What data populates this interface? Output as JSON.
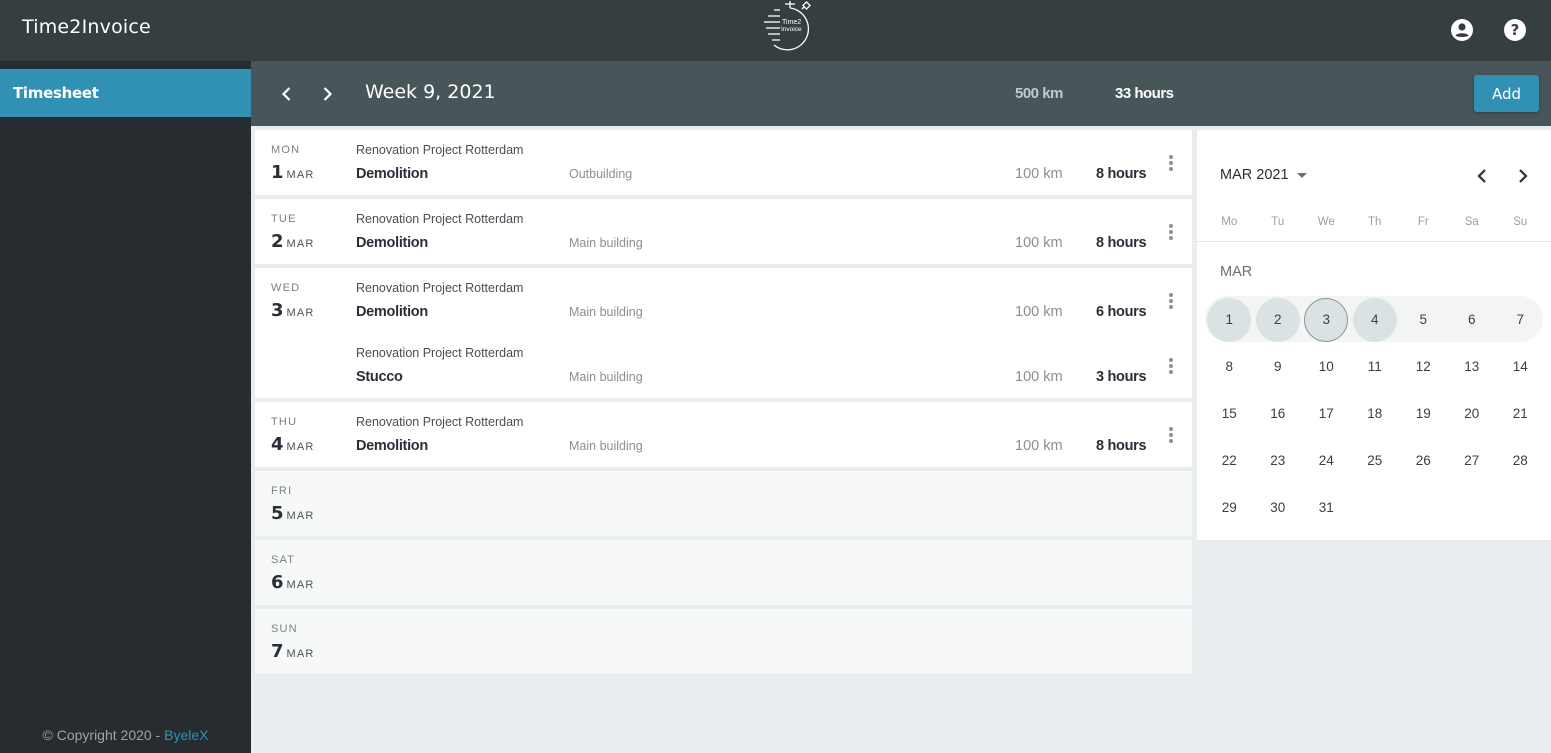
{
  "app": {
    "title": "Time2Invoice",
    "logo_text_line1": "Time2",
    "logo_text_line2": "Invoice",
    "icons": {
      "account": "account-circle-icon",
      "help": "help-icon"
    }
  },
  "sidebar": {
    "items": [
      {
        "label": "Timesheet",
        "active": true
      }
    ],
    "copyright_prefix": "© Copyright 2020 - ",
    "copyright_link": "ByeleX"
  },
  "week": {
    "title": "Week 9, 2021",
    "total_km": "500 km",
    "total_hours": "33 hours",
    "add_label": "Add"
  },
  "days": [
    {
      "dow": "MON",
      "num": "1",
      "mon": "MAR",
      "entries": [
        {
          "project": "Renovation Project Rotterdam",
          "task": "Demolition",
          "location": "Outbuilding",
          "km": "100 km",
          "hours": "8 hours"
        }
      ]
    },
    {
      "dow": "TUE",
      "num": "2",
      "mon": "MAR",
      "entries": [
        {
          "project": "Renovation Project Rotterdam",
          "task": "Demolition",
          "location": "Main building",
          "km": "100 km",
          "hours": "8 hours"
        }
      ]
    },
    {
      "dow": "WED",
      "num": "3",
      "mon": "MAR",
      "entries": [
        {
          "project": "Renovation Project Rotterdam",
          "task": "Demolition",
          "location": "Main building",
          "km": "100 km",
          "hours": "6 hours"
        },
        {
          "project": "Renovation Project Rotterdam",
          "task": "Stucco",
          "location": "Main building",
          "km": "100 km",
          "hours": "3 hours"
        }
      ]
    },
    {
      "dow": "THU",
      "num": "4",
      "mon": "MAR",
      "entries": [
        {
          "project": "Renovation Project Rotterdam",
          "task": "Demolition",
          "location": "Main building",
          "km": "100 km",
          "hours": "8 hours"
        }
      ]
    },
    {
      "dow": "FRI",
      "num": "5",
      "mon": "MAR",
      "entries": []
    },
    {
      "dow": "SAT",
      "num": "6",
      "mon": "MAR",
      "entries": []
    },
    {
      "dow": "SUN",
      "num": "7",
      "mon": "MAR",
      "entries": []
    }
  ],
  "calendar": {
    "header": "MAR 2021",
    "month_label": "MAR",
    "weekdays": [
      "Mo",
      "Tu",
      "We",
      "Th",
      "Fr",
      "Sa",
      "Su"
    ],
    "weeks": [
      [
        "1",
        "2",
        "3",
        "4",
        "5",
        "6",
        "7"
      ],
      [
        "8",
        "9",
        "10",
        "11",
        "12",
        "13",
        "14"
      ],
      [
        "15",
        "16",
        "17",
        "18",
        "19",
        "20",
        "21"
      ],
      [
        "22",
        "23",
        "24",
        "25",
        "26",
        "27",
        "28"
      ],
      [
        "29",
        "30",
        "31",
        "",
        "",
        "",
        ""
      ]
    ],
    "filled_days": [
      "1",
      "2",
      "3",
      "4"
    ],
    "today": "3"
  }
}
